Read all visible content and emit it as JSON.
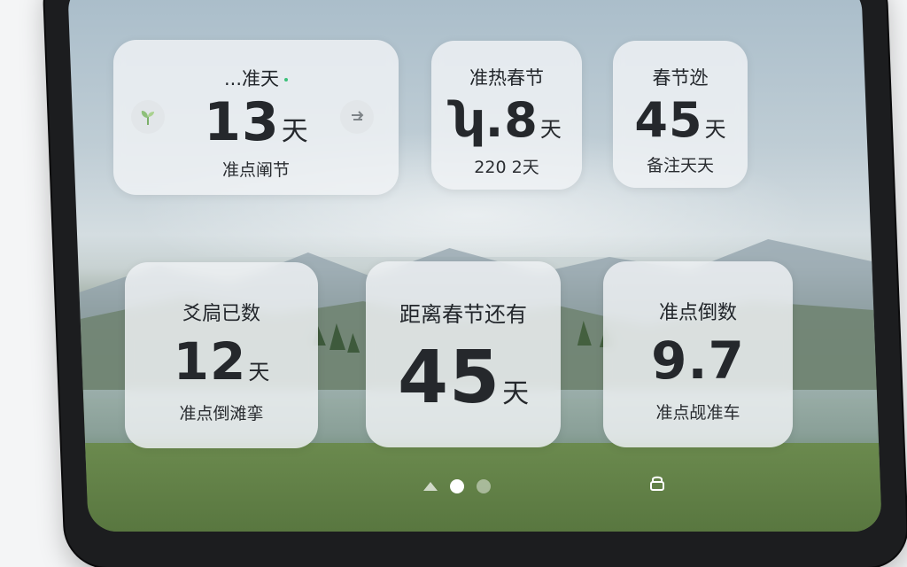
{
  "widgets": [
    {
      "title": "...准天",
      "number": "13",
      "unit": "天",
      "subtitle": "准点阐节",
      "left_icon": "sprout-icon",
      "right_icon": "swap-icon"
    },
    {
      "title": "准热春节",
      "number": "ʮ.8",
      "unit": "天",
      "subtitle": "220 2天"
    },
    {
      "title": "春节迯",
      "number": "45",
      "unit": "天",
      "subtitle": "备注天天"
    },
    {
      "title": "爻扃已数",
      "number": "12",
      "unit": "天",
      "subtitle": "准点倒滩挛"
    },
    {
      "title": "距离春节还有",
      "number": "45",
      "unit": "天"
    },
    {
      "title": "准点倒数",
      "number": "9.7",
      "subtitle": "准点觇准车"
    }
  ],
  "pager": {
    "page_count": 3,
    "active_index": 1
  },
  "icons": {
    "pager_first": "home-icon",
    "dock": "lock-icon"
  },
  "colors": {
    "accent_dot": "#3cc07a",
    "card_bg": "#f0f3f5",
    "text": "#22262b"
  }
}
